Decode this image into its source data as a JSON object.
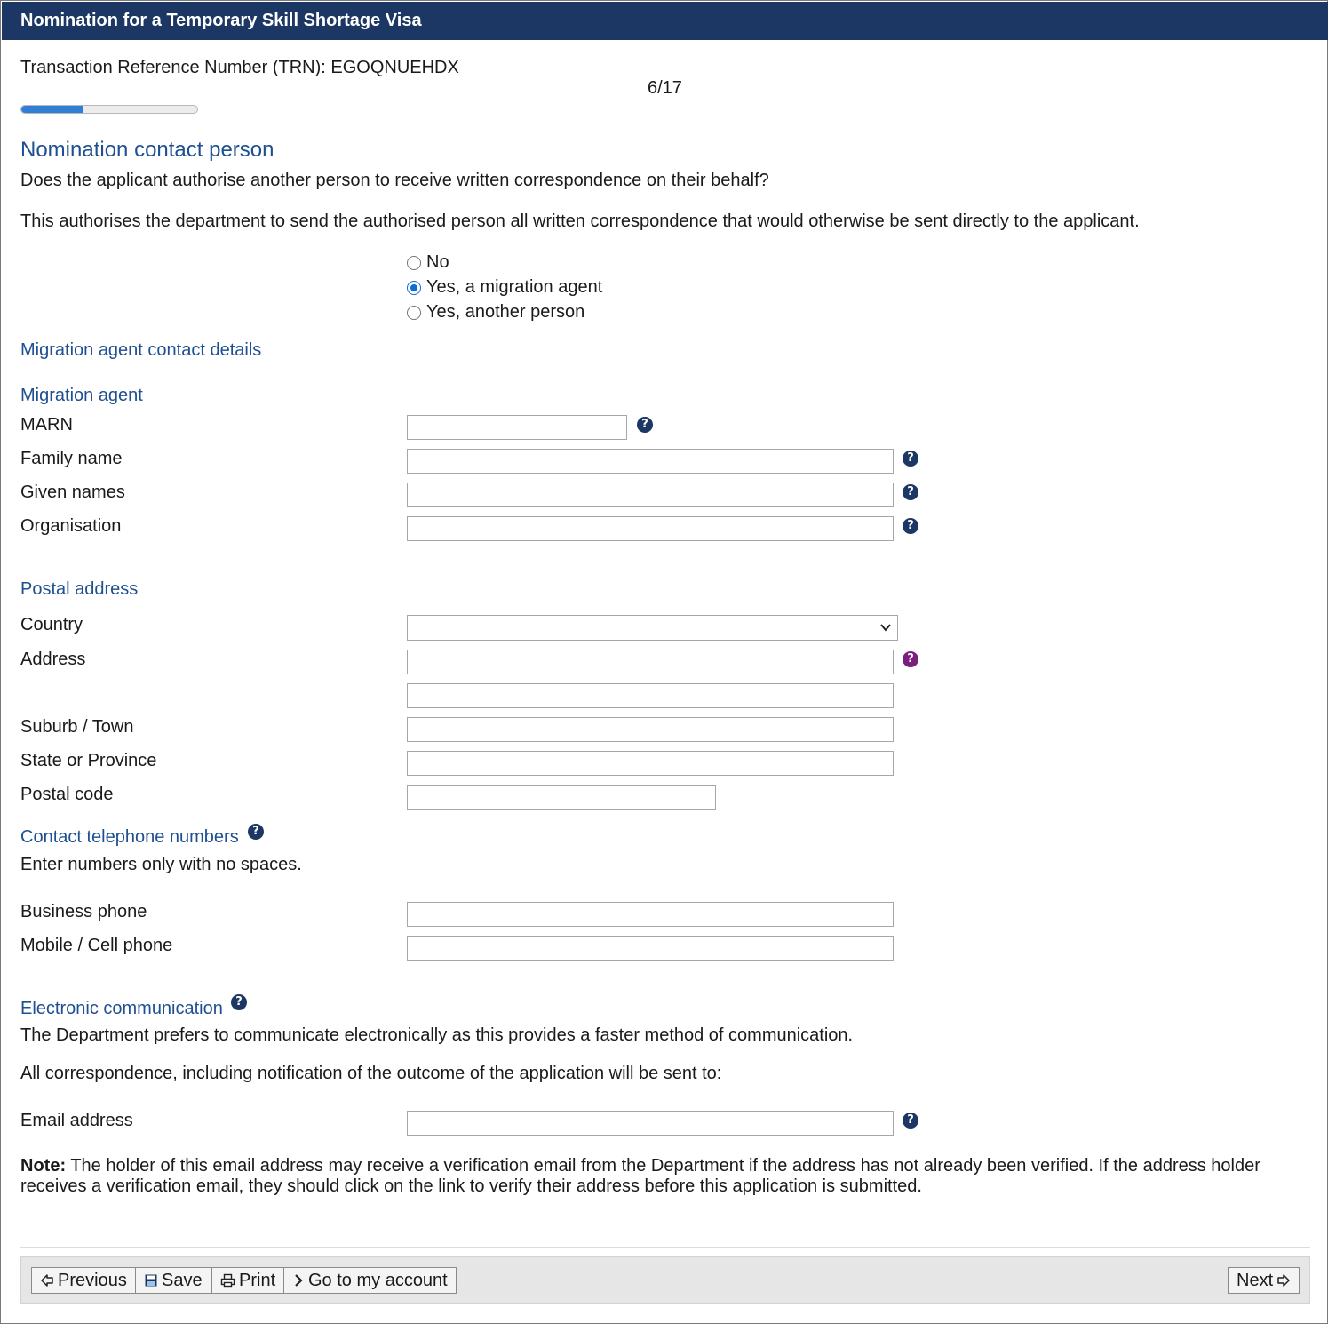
{
  "header": {
    "title": "Nomination for a Temporary Skill Shortage Visa"
  },
  "trn": {
    "label": "Transaction Reference Number (TRN): EGOQNUEHDX"
  },
  "progress": {
    "text": "6/17",
    "current": 6,
    "total": 17,
    "fraction": 0.353
  },
  "section": {
    "title": "Nomination contact person",
    "question": "Does the applicant authorise another person to receive written correspondence on their behalf?",
    "explanation": "This authorises the department to send the authorised person all written correspondence that would otherwise be sent directly to the applicant."
  },
  "radio_options": [
    {
      "label": "No",
      "checked": false
    },
    {
      "label": "Yes, a migration agent",
      "checked": true
    },
    {
      "label": "Yes, another person",
      "checked": false
    }
  ],
  "agent_details": {
    "heading": "Migration agent contact details",
    "subheading": "Migration agent",
    "fields": {
      "marn": {
        "label": "MARN",
        "value": ""
      },
      "family_name": {
        "label": "Family name",
        "value": ""
      },
      "given_names": {
        "label": "Given names",
        "value": ""
      },
      "organisation": {
        "label": "Organisation",
        "value": ""
      }
    }
  },
  "postal": {
    "heading": "Postal address",
    "country": {
      "label": "Country",
      "value": ""
    },
    "address": {
      "label": "Address",
      "line1": "",
      "line2": ""
    },
    "suburb": {
      "label": "Suburb / Town",
      "value": ""
    },
    "state": {
      "label": "State or Province",
      "value": ""
    },
    "postcode": {
      "label": "Postal code",
      "value": ""
    }
  },
  "phones": {
    "heading": "Contact telephone numbers",
    "hint": "Enter numbers only with no spaces.",
    "business": {
      "label": "Business phone",
      "value": ""
    },
    "mobile": {
      "label": "Mobile / Cell phone",
      "value": ""
    }
  },
  "electronic": {
    "heading": "Electronic communication",
    "text1": "The Department prefers to communicate electronically as this provides a faster method of communication.",
    "text2": "All correspondence, including notification of the outcome of the application will be sent to:",
    "email": {
      "label": "Email address",
      "value": ""
    },
    "note_label": "Note:",
    "note_line1": "The holder of this email address may receive a verification email from the Department if the address has not already been verified. If the address holder",
    "note_line2": "receives a verification email, they should click on the link to verify their address before this application is submitted."
  },
  "help_icon_glyph": "?",
  "colors": {
    "header_bg": "#1c3764",
    "heading": "#1d4f91",
    "progress": "#2f7fd6",
    "help_alt": "#7a1f80"
  },
  "footer": {
    "previous": "Previous",
    "save": "Save",
    "print": "Print",
    "account": "Go to my account",
    "next": "Next"
  }
}
